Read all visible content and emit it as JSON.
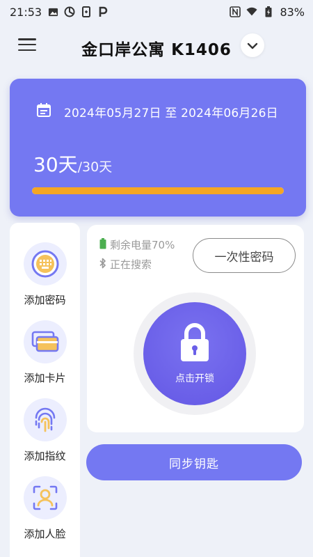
{
  "status_bar": {
    "time": "21:53",
    "battery": "83%"
  },
  "header": {
    "title": "金口岸公寓 K1406"
  },
  "lease": {
    "date_range": "2024年05月27日 至 2024年06月26日",
    "days_used": "30天",
    "days_total": "/30天",
    "progress_fraction": 1.0
  },
  "sidebar": {
    "items": [
      {
        "label": "添加密码",
        "icon": "keypad-icon"
      },
      {
        "label": "添加卡片",
        "icon": "card-icon"
      },
      {
        "label": "添加指纹",
        "icon": "fingerprint-icon"
      },
      {
        "label": "添加人脸",
        "icon": "face-icon"
      }
    ]
  },
  "lock_panel": {
    "battery_text": "剩余电量70%",
    "bluetooth_text": "正在搜索",
    "otp_label": "一次性密码",
    "unlock_label": "点击开锁"
  },
  "sync_label": "同步钥匙",
  "colors": {
    "primary": "#7478f2",
    "progress": "#f5a623",
    "battery_green": "#4caf50"
  }
}
